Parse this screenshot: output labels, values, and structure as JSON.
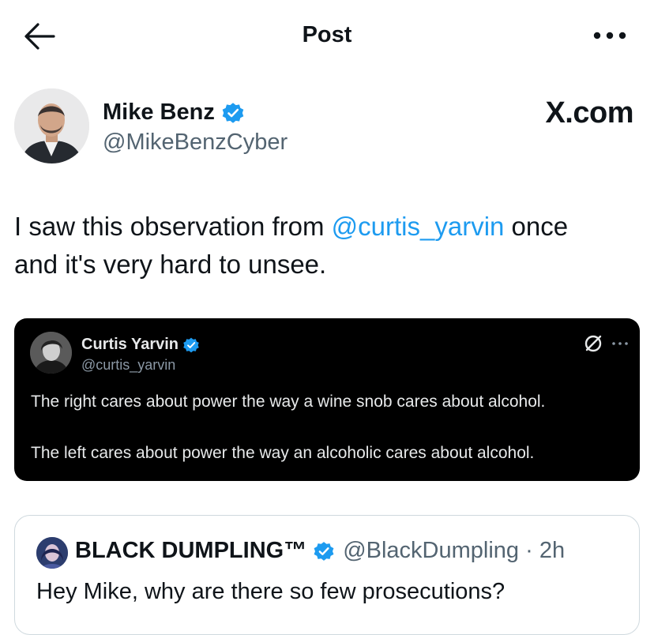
{
  "header": {
    "title": "Post",
    "back_icon": "arrow-left-icon",
    "more_icon": "more-horizontal-icon"
  },
  "author": {
    "name": "Mike Benz",
    "handle": "@MikeBenzCyber",
    "verified": true,
    "watermark": "X.com"
  },
  "post": {
    "text_before": "I saw this observation from ",
    "mention": "@curtis_yarvin",
    "text_after_line1": " once",
    "text_line2": "and it's very hard to unsee."
  },
  "embedded_tweet": {
    "name": "Curtis Yarvin",
    "handle": "@curtis_yarvin",
    "verified": true,
    "line1": "The right cares about power the way a wine snob cares about alcohol.",
    "line2": "The left cares about power the way an alcoholic cares about alcohol."
  },
  "reply": {
    "name": "BLACK DUMPLING™",
    "handle_time": "@BlackDumpling · 2h",
    "verified": true,
    "text": "Hey Mike, why are there so few prosecutions?"
  },
  "colors": {
    "accent": "#1d9bf0",
    "text": "#0f1419",
    "muted": "#536471",
    "card_bg": "#000000"
  }
}
